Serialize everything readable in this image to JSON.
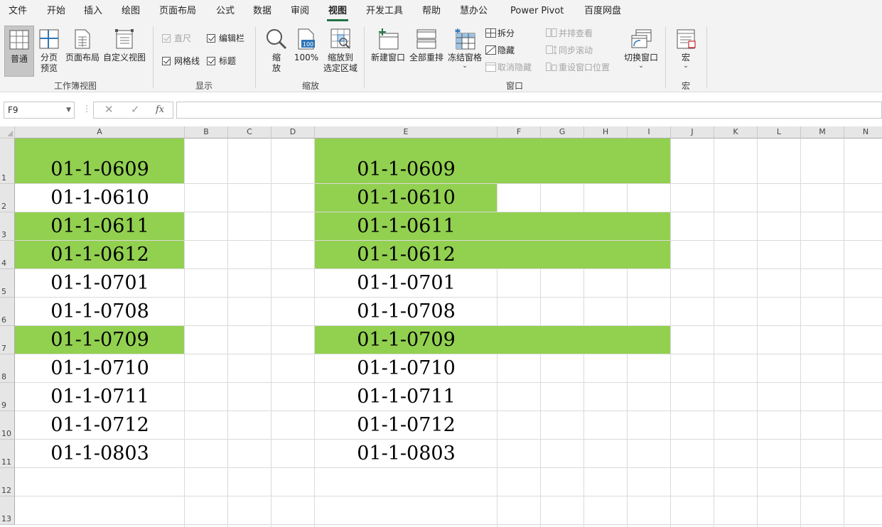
{
  "menu": {
    "tabs": [
      "文件",
      "开始",
      "插入",
      "绘图",
      "页面布局",
      "公式",
      "数据",
      "审阅",
      "视图",
      "开发工具",
      "帮助",
      "慧办公",
      "Power Pivot",
      "百度网盘"
    ],
    "active": "视图"
  },
  "ribbon": {
    "workbook_views": {
      "normal": "普通",
      "page_break": [
        "分页",
        "预览"
      ],
      "page_layout": "页面布局",
      "custom": "自定义视图",
      "group": "工作簿视图"
    },
    "show": {
      "ruler": "直尺",
      "formula_bar": "编辑栏",
      "gridlines": "网格线",
      "headings": "标题",
      "group": "显示"
    },
    "zoom": {
      "zoom": [
        "缩",
        "放"
      ],
      "hundred": "100%",
      "icon_badge": "100",
      "to_selection": [
        "缩放到",
        "选定区域"
      ],
      "group": "缩放"
    },
    "window": {
      "new_window": "新建窗口",
      "arrange_all": "全部重排",
      "freeze": "冻结窗格",
      "split": "拆分",
      "hide": "隐藏",
      "unhide": "取消隐藏",
      "side_by_side": "并排查看",
      "sync_scroll": "同步滚动",
      "reset_position": "重设窗口位置",
      "switch": "切换窗口",
      "group": "窗口"
    },
    "macros": {
      "macro": "宏",
      "group": "宏"
    }
  },
  "formula_bar": {
    "name_box": "F9",
    "formula": ""
  },
  "columns": [
    "A",
    "B",
    "C",
    "D",
    "E",
    "F",
    "G",
    "H",
    "I",
    "J",
    "K",
    "L",
    "M",
    "N"
  ],
  "rows": [
    "1",
    "2",
    "3",
    "4",
    "5",
    "6",
    "7",
    "8",
    "9",
    "10",
    "11",
    "12",
    "13"
  ],
  "cells": {
    "A": [
      "01-1-0609",
      "01-1-0610",
      "01-1-0611",
      "01-1-0612",
      "01-1-0701",
      "01-1-0708",
      "01-1-0709",
      "01-1-0710",
      "01-1-0711",
      "01-1-0712",
      "01-1-0803"
    ],
    "E": [
      "01-1-0609",
      "01-1-0610",
      "01-1-0611",
      "01-1-0612",
      "01-1-0701",
      "01-1-0708",
      "01-1-0709",
      "01-1-0710",
      "01-1-0711",
      "01-1-0712",
      "01-1-0803"
    ]
  },
  "highlight": {
    "color": "#92d050",
    "A_rows": [
      1,
      3,
      4,
      7
    ],
    "E_to_I_rows": [
      1,
      3,
      4,
      7
    ],
    "E_only_rows": [
      2
    ]
  },
  "colors": {
    "ribbon_bg": "#f3f3f3",
    "accent": "#217346",
    "header_bg": "#e6e6e6",
    "gridline": "#dadada"
  }
}
